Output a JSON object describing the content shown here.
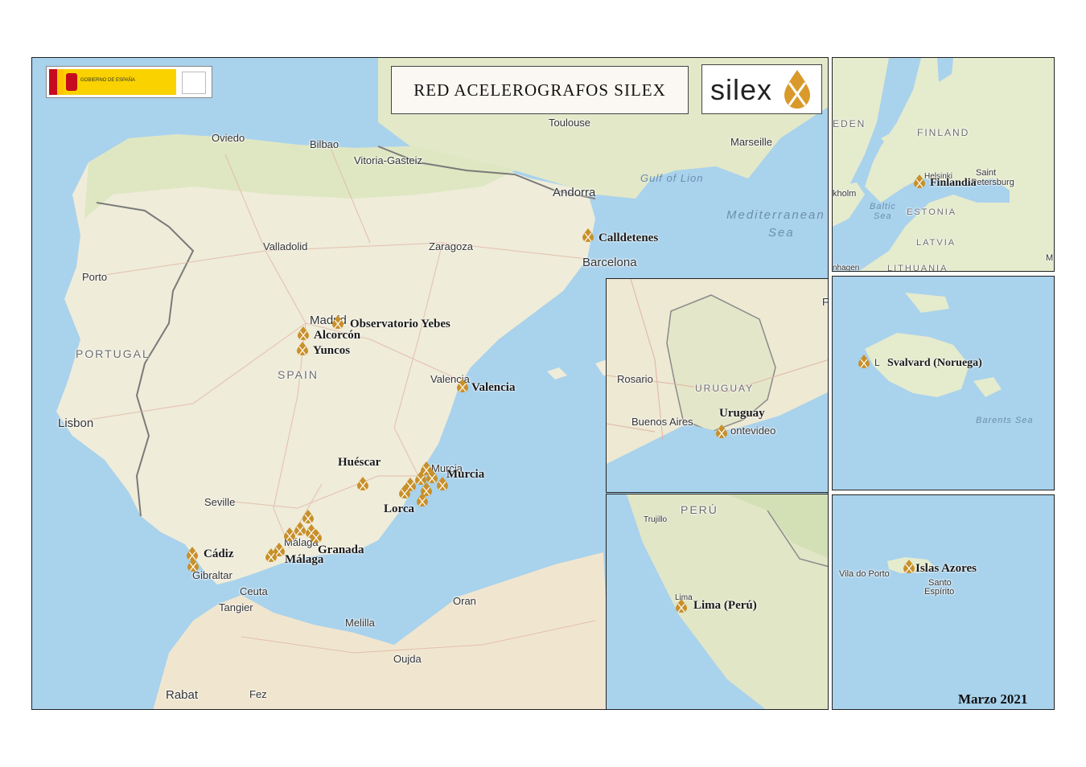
{
  "title": "RED ACELEROGRAFOS SILEX",
  "logo": {
    "brand": "silex",
    "gov_text": "GOBIERNO DE ESPAÑA"
  },
  "date": "Marzo 2021",
  "main_map": {
    "cities": [
      "Oviedo",
      "Bilbao",
      "Vitoria-Gasteiz",
      "Toulouse",
      "Marseille",
      "Andorra",
      "Valladolid",
      "Zaragoza",
      "Barcelona",
      "Porto",
      "Madrid",
      "Valencia",
      "Lisbon",
      "Seville",
      "Murcia",
      "Gibraltar",
      "Ceuta",
      "Tangier",
      "Oran",
      "Melilla",
      "Oujda",
      "Rabat",
      "Fez",
      "Málaga"
    ],
    "countries": [
      "PORTUGAL",
      "SPAIN"
    ],
    "seas": [
      "Gulf of Lion",
      "Mediterranean",
      "Sea"
    ],
    "stations": [
      "Calldetenes",
      "Observatorio Yebes",
      "Alcorcón",
      "Yuncos",
      "Valencia",
      "Huéscar",
      "Murcia",
      "Lorca",
      "Cádiz",
      "Granada",
      "Málaga"
    ]
  },
  "inset_finland": {
    "labels": [
      "FINLAND",
      "EDEN",
      "Saint",
      "Petersburg",
      "Helsinki",
      "kholm",
      "Baltic",
      "Sea",
      "ESTONIA",
      "LATVIA",
      "nhagen",
      "LITHUANIA",
      "M"
    ],
    "station": "Finlandia"
  },
  "inset_svalbard": {
    "labels": [
      "Barents Sea",
      "L"
    ],
    "station": "Svalvard (Noruega)"
  },
  "inset_uruguay": {
    "labels": [
      "Rosario",
      "URUGUAY",
      "Buenos Aires",
      "ontevideo",
      "F"
    ],
    "station": "Uruguay"
  },
  "inset_peru": {
    "labels": [
      "PERÚ",
      "Trujillo",
      "Lima"
    ],
    "station": "Lima (Perú)"
  },
  "inset_azores": {
    "labels": [
      "Vila do Porto",
      "Santo",
      "Espírito"
    ],
    "station": "Islas Azores"
  },
  "colors": {
    "sea": "#a9d2ec",
    "land": "#efecd9",
    "land_green": "#dfe7c2",
    "desert": "#f0e6cf",
    "marker": "#c8902a",
    "border": "#7a7a7a"
  }
}
